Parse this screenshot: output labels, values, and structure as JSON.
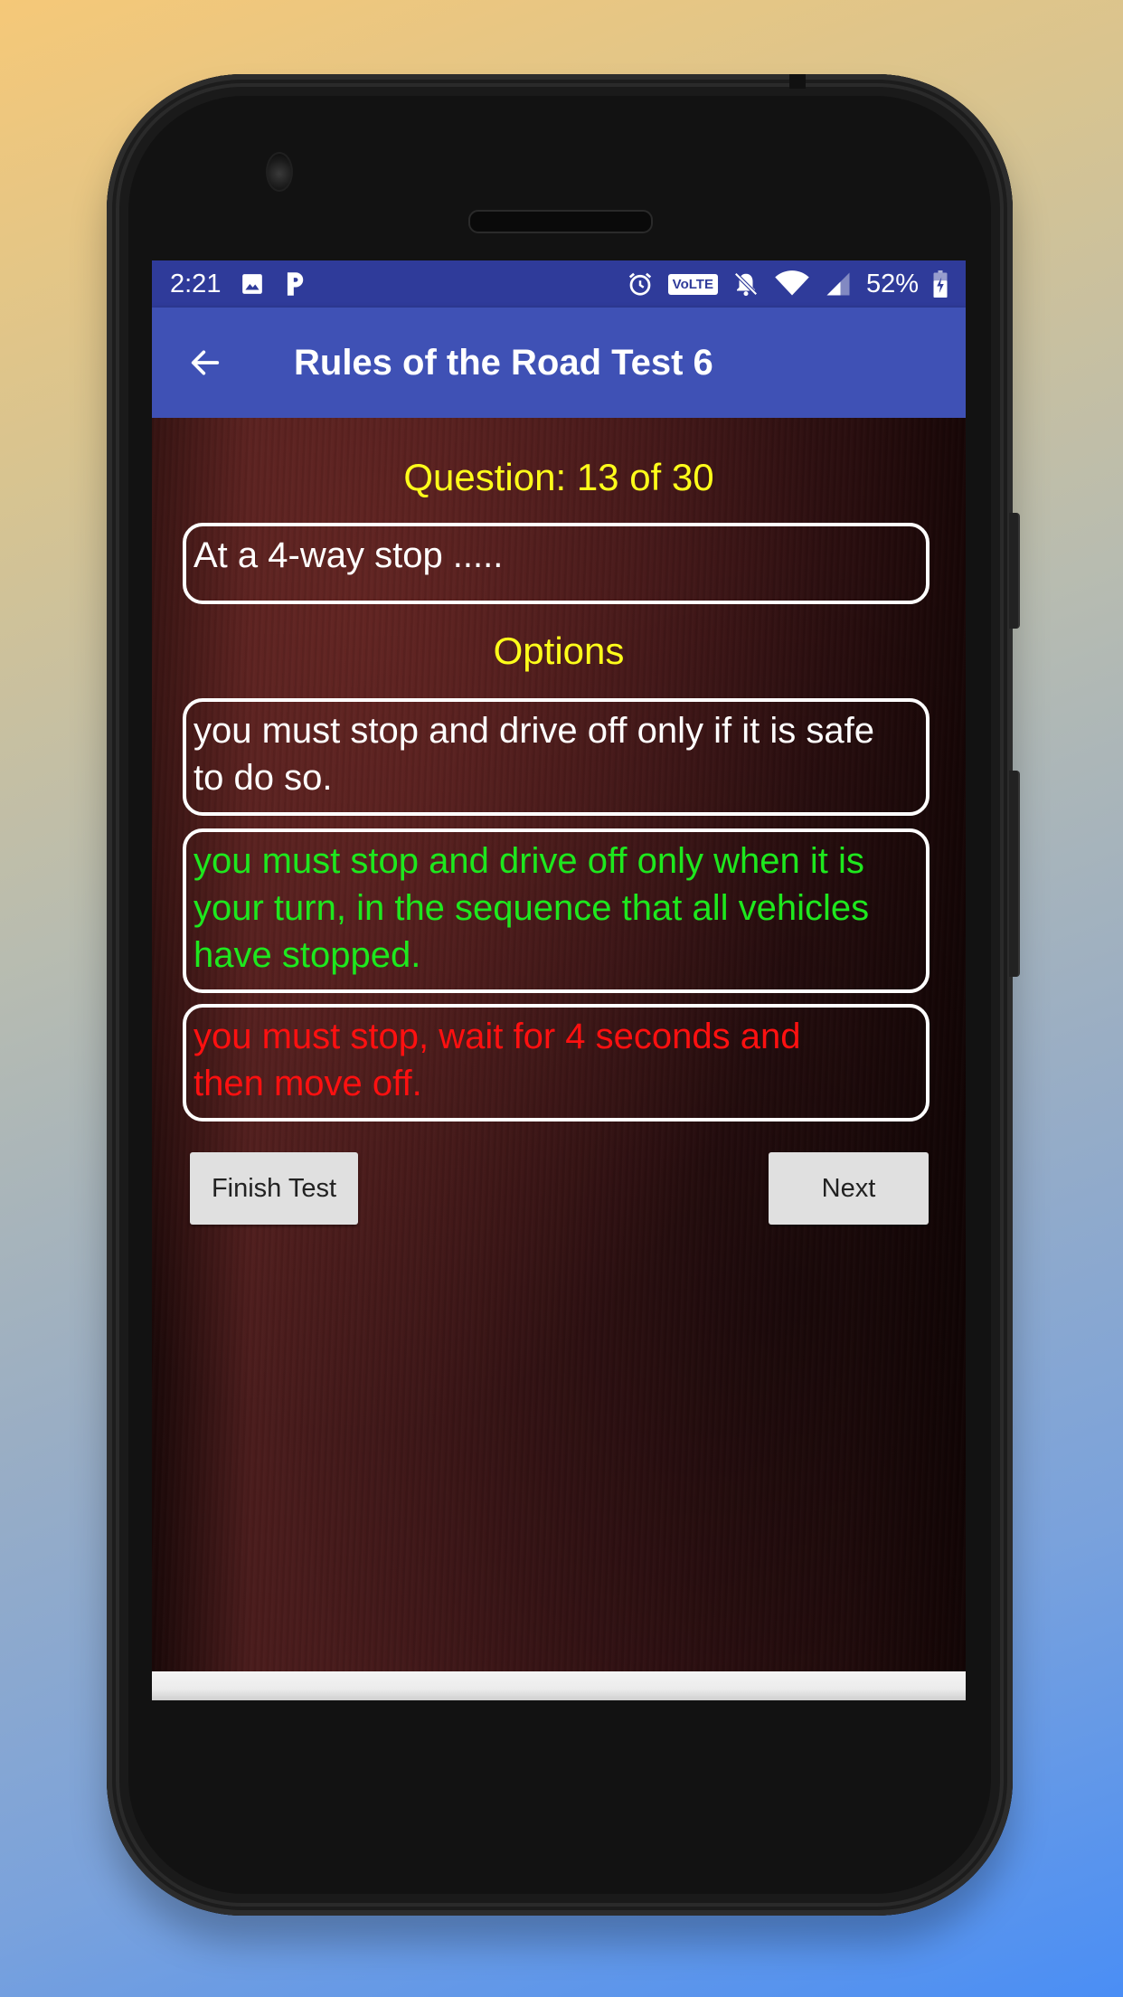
{
  "status_bar": {
    "time": "2:21",
    "left_icons": [
      "image-icon",
      "p-app-icon"
    ],
    "right_icons": [
      "alarm-icon",
      "volte-icon",
      "notifications-off-icon",
      "wifi-icon",
      "cell-signal-icon"
    ],
    "volte_label": "VoLTE",
    "battery_percent": "52%",
    "battery_icon": "battery-charging-icon"
  },
  "app_bar": {
    "back_icon": "arrow-left-icon",
    "title": "Rules of the Road Test 6"
  },
  "quiz": {
    "counter": "Question: 13 of 30",
    "current": 13,
    "total": 30,
    "question": "At a 4-way stop .....",
    "options_label": "Options",
    "options": [
      {
        "text": "you must stop and drive off only if it is safe to do so.",
        "state": "neutral",
        "color": "#ffffff"
      },
      {
        "text": "you must stop and drive off only when it is your turn, in the sequence that all vehicles have stopped.",
        "state": "correct",
        "color": "#1ee81e"
      },
      {
        "text": "you must stop, wait for 4 seconds and then move off.",
        "state": "incorrect",
        "color": "#ff1010"
      }
    ]
  },
  "buttons": {
    "finish": "Finish Test",
    "next": "Next"
  },
  "colors": {
    "status_bar": "#2f3b9a",
    "app_bar": "#3f51b5",
    "heading_yellow": "#ffff1a",
    "correct_green": "#1ee81e",
    "incorrect_red": "#ff1010",
    "button_bg": "#e0e0e0"
  }
}
